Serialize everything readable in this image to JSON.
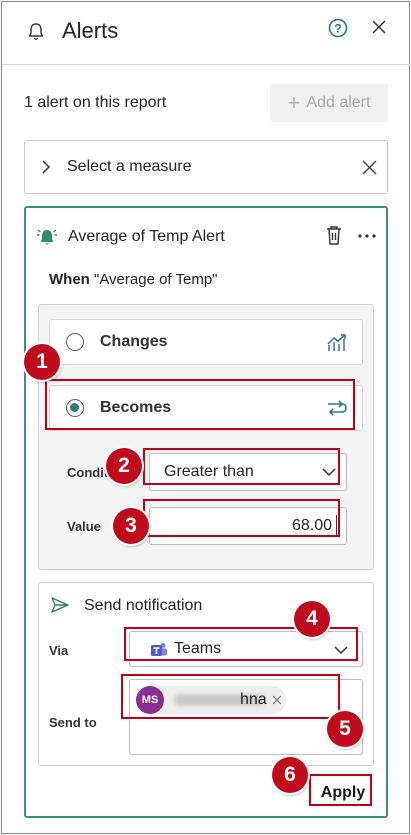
{
  "header": {
    "title": "Alerts",
    "bell_icon": "bell-icon",
    "help_icon": "help-icon",
    "close_icon": "close-icon"
  },
  "summary": {
    "count_text": "1 alert on this report",
    "add_alert_label": "Add alert"
  },
  "measure_selector": {
    "label": "Select a measure"
  },
  "alert": {
    "name": "Average of Temp Alert",
    "when_label": "When",
    "when_value": "\"Average of Temp\"",
    "options": [
      {
        "label": "Changes",
        "selected": false,
        "icon": "trend-chart-icon"
      },
      {
        "label": "Becomes",
        "selected": true,
        "icon": "threshold-icon"
      }
    ],
    "condition_label": "Condit",
    "condition_value": "Greater than",
    "value_label": "Value",
    "value": "68.00"
  },
  "notification": {
    "title": "Send notification",
    "via_label": "Via",
    "via_value": "Teams",
    "send_to_label": "Send to",
    "recipient_initials": "MS",
    "recipient_suffix": "hna"
  },
  "apply_label": "Apply",
  "callouts": [
    "1",
    "2",
    "3",
    "4",
    "5",
    "6"
  ],
  "colors": {
    "accent": "#2f7d6c",
    "callout": "#c00b1c",
    "teams": "#5059c9"
  }
}
